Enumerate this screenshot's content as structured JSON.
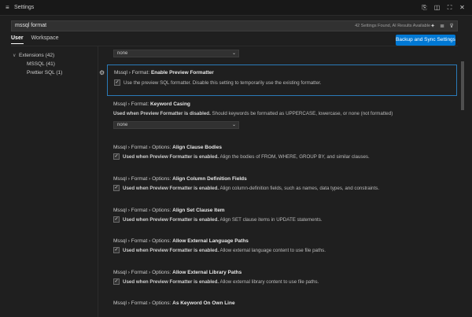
{
  "window": {
    "title": "Settings",
    "menu_icon": "hamburger-icon",
    "actions": [
      "split-editor-icon",
      "layout-icon",
      "fullscreen-icon",
      "close-icon"
    ]
  },
  "search": {
    "query": "mssql format",
    "result_count": "42 Settings Found, AI Results Available",
    "tools": [
      "sparkle-icon",
      "clear-filter-icon",
      "filter-icon"
    ]
  },
  "tabs": [
    {
      "label": "User",
      "active": true
    },
    {
      "label": "Workspace",
      "active": false
    }
  ],
  "sync_button": "Backup and Sync Settings",
  "toc": {
    "group": "Extensions (42)",
    "items": [
      "MSSQL (41)",
      "Prettier SQL (1)"
    ]
  },
  "top_select": {
    "value": "none"
  },
  "settings": [
    {
      "prefix": "Mssql › Format: ",
      "name": "Enable Preview Formatter",
      "check_label": "",
      "desc": "Use the preview SQL formatter. Disable this setting to temporarily use the existing formatter.",
      "checked": true
    },
    {
      "prefix": "Mssql › Format: ",
      "name": "Keyword Casing",
      "bold_desc": "Used when Preview Formatter is disabled.",
      "desc": " Should keywords be formatted as UPPERCASE, lowercase, or none (not formatted)",
      "select_value": "none"
    },
    {
      "prefix": "Mssql › Format › Options: ",
      "name": "Align Clause Bodies",
      "bold_desc": "Used when Preview Formatter is enabled.",
      "desc": " Align the bodies of FROM, WHERE, GROUP BY, and similar clauses.",
      "checked": true
    },
    {
      "prefix": "Mssql › Format › Options: ",
      "name": "Align Column Definition Fields",
      "bold_desc": "Used when Preview Formatter is enabled.",
      "desc": " Align column-definition fields, such as names, data types, and constraints.",
      "checked": true
    },
    {
      "prefix": "Mssql › Format › Options: ",
      "name": "Align Set Clause Item",
      "bold_desc": "Used when Preview Formatter is enabled.",
      "desc": " Align SET clause items in UPDATE statements.",
      "checked": true
    },
    {
      "prefix": "Mssql › Format › Options: ",
      "name": "Allow External Language Paths",
      "bold_desc": "Used when Preview Formatter is enabled.",
      "desc": " Allow external language content to use file paths.",
      "checked": true
    },
    {
      "prefix": "Mssql › Format › Options: ",
      "name": "Allow External Library Paths",
      "bold_desc": "Used when Preview Formatter is enabled.",
      "desc": " Allow external library content to use file paths.",
      "checked": true
    },
    {
      "prefix": "Mssql › Format › Options: ",
      "name": "As Keyword On Own Line"
    }
  ],
  "icons": {
    "check": "✓",
    "chevron_down": "⌄",
    "gear": "⚙",
    "chevron_tree": "∨"
  }
}
